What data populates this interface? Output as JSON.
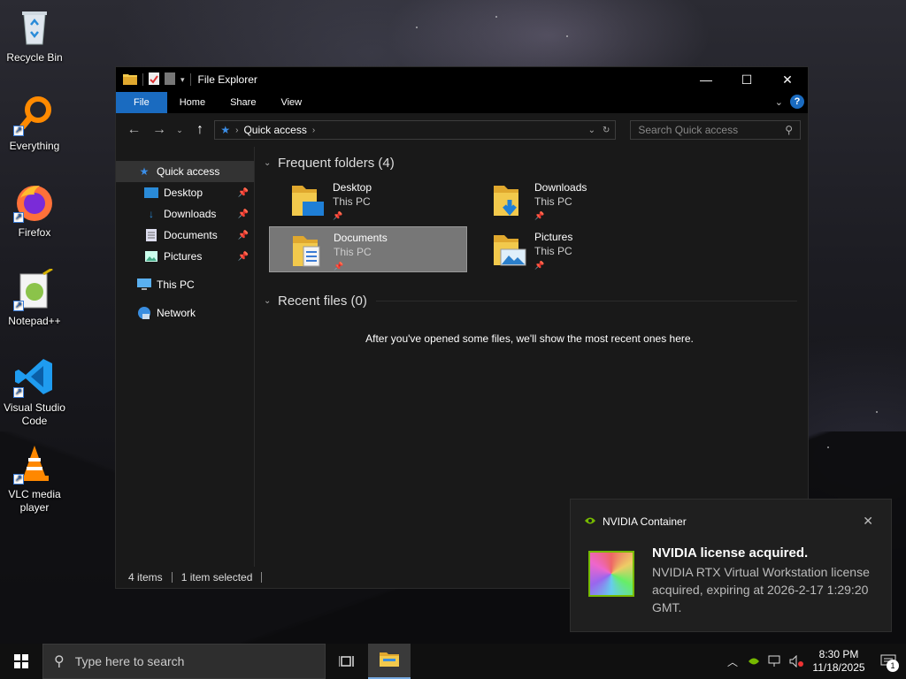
{
  "desktop": {
    "icons": [
      {
        "label": "Recycle Bin",
        "icon": "recycle-bin-icon"
      },
      {
        "label": "Everything",
        "icon": "everything-search-icon"
      },
      {
        "label": "Firefox",
        "icon": "firefox-icon"
      },
      {
        "label": "Notepad++",
        "icon": "notepadpp-icon"
      },
      {
        "label": "Visual Studio Code",
        "icon": "vscode-icon"
      },
      {
        "label": "VLC media player",
        "icon": "vlc-icon"
      }
    ]
  },
  "explorer": {
    "title": "File Explorer",
    "ribbon_tabs": [
      "File",
      "Home",
      "Share",
      "View"
    ],
    "address": {
      "crumb": "Quick access"
    },
    "search_placeholder": "Search Quick access",
    "nav": {
      "quick_access": "Quick access",
      "pinned": [
        {
          "label": "Desktop",
          "icon": "desktop-icon"
        },
        {
          "label": "Downloads",
          "icon": "downloads-icon"
        },
        {
          "label": "Documents",
          "icon": "documents-icon"
        },
        {
          "label": "Pictures",
          "icon": "pictures-icon"
        }
      ],
      "this_pc": "This PC",
      "network": "Network"
    },
    "frequent_header": "Frequent folders (4)",
    "frequent": [
      {
        "name": "Desktop",
        "location": "This PC",
        "selected": false
      },
      {
        "name": "Downloads",
        "location": "This PC",
        "selected": false
      },
      {
        "name": "Documents",
        "location": "This PC",
        "selected": true
      },
      {
        "name": "Pictures",
        "location": "This PC",
        "selected": false
      }
    ],
    "recent_header": "Recent files (0)",
    "recent_empty": "After you've opened some files, we'll show the most recent ones here.",
    "status": {
      "items": "4 items",
      "selected": "1 item selected"
    }
  },
  "notification": {
    "app": "NVIDIA Container",
    "title": "NVIDIA license acquired.",
    "body": "NVIDIA RTX Virtual Workstation license acquired, expiring at 2026-2-17 1:29:20 GMT."
  },
  "taskbar": {
    "search_placeholder": "Type here to search",
    "time": "8:30 PM",
    "date": "11/18/2025",
    "notification_count": "1"
  },
  "colors": {
    "accent": "#1a6bc0",
    "nvidia_green": "#76b900",
    "folder_yellow": "#f2c94c"
  }
}
